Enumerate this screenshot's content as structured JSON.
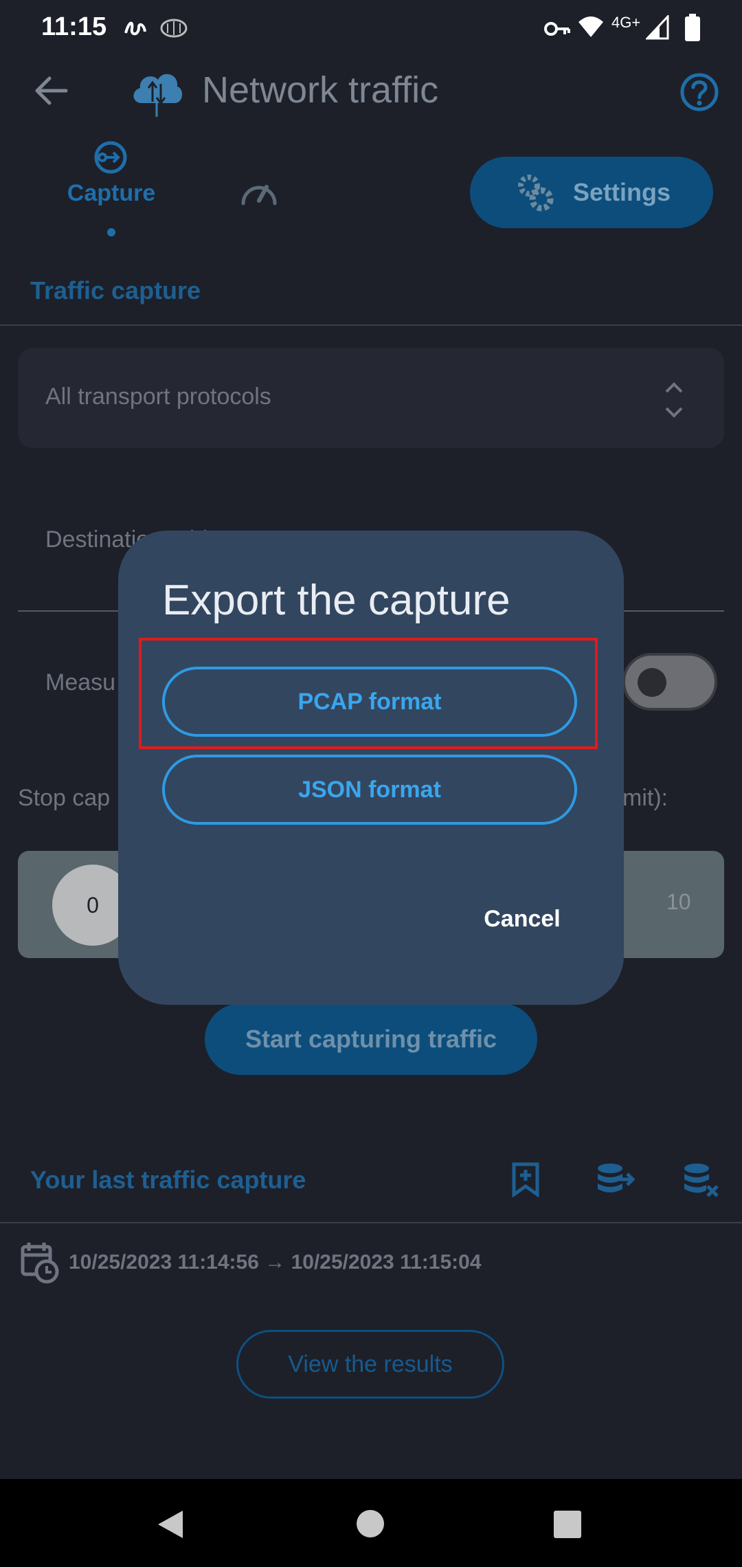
{
  "status_bar": {
    "time": "11:15",
    "network": "4G+"
  },
  "app_bar": {
    "title": "Network traffic"
  },
  "tabs": [
    {
      "label": "Capture"
    },
    {
      "label": ""
    }
  ],
  "settings_button": {
    "label": "Settings"
  },
  "capture": {
    "section_title": "Traffic capture",
    "protocol_select": "All transport protocols",
    "destination_label": "Destination address or port ",
    "measure_label": "Measu",
    "stop_label_left": "Stop cap",
    "stop_label_right": "mit):",
    "slider_min": "0",
    "slider_max": "10",
    "start_button": "Start capturing traffic"
  },
  "last_capture": {
    "title": "Your last traffic capture",
    "range": "10/25/2023 11:14:56 → 10/25/2023 11:15:04",
    "view_button": "View the results"
  },
  "dialog": {
    "title": "Export the capture",
    "pcap_button": "PCAP format",
    "json_button": "JSON format",
    "cancel_button": "Cancel"
  },
  "colors": {
    "background": "#1d2029",
    "dialog": "#33465f",
    "accent": "#2d9be4",
    "highlight": "#e01b1b"
  }
}
